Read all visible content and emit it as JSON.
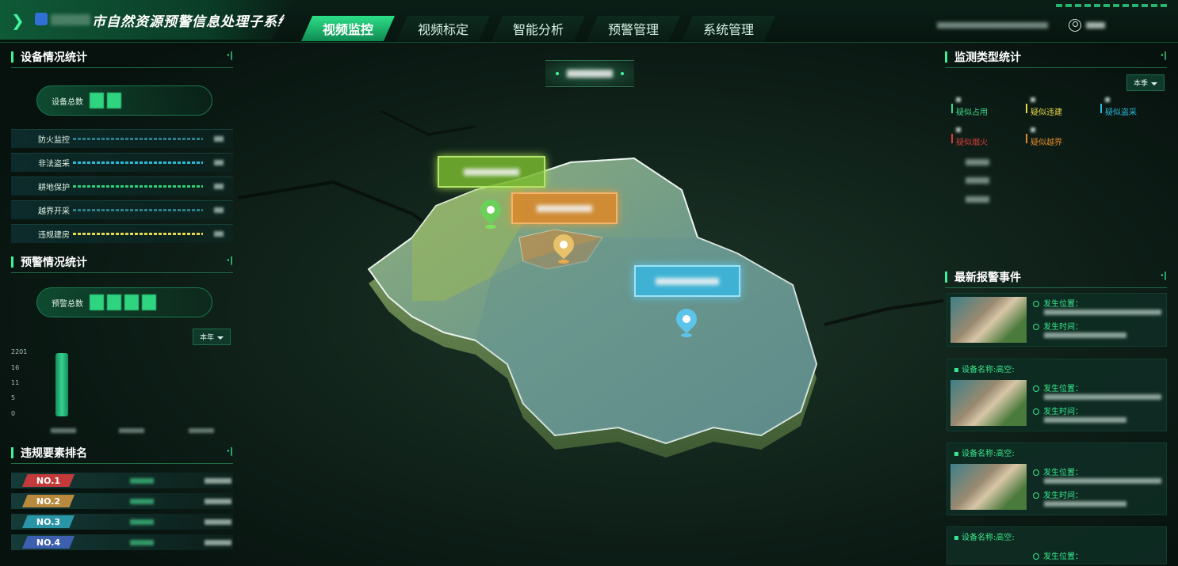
{
  "header": {
    "title": "市自然资源预警信息处理子系统",
    "tabs": [
      "视频监控",
      "视频标定",
      "智能分析",
      "预警管理",
      "系统管理"
    ],
    "active_tab": 0
  },
  "device_stats": {
    "heading": "设备情况统计",
    "total_label": "设备总数",
    "rows": [
      {
        "label": "防火监控",
        "color": "#2a7f8a"
      },
      {
        "label": "非法盗采",
        "color": "#2bb8d8"
      },
      {
        "label": "耕地保护",
        "color": "#2fcf72"
      },
      {
        "label": "越界开采",
        "color": "#2a7f8a"
      },
      {
        "label": "违规建房",
        "color": "#e6d84a"
      }
    ]
  },
  "alert_stats": {
    "heading": "预警情况统计",
    "total_label": "预警总数",
    "period": "本年",
    "y_ticks": [
      "2201",
      "16",
      "11",
      "5",
      "0"
    ]
  },
  "ranking": {
    "heading": "违规要素排名",
    "items": [
      {
        "rank": "NO.1",
        "color": "#c43a3a"
      },
      {
        "rank": "NO.2",
        "color": "#b98a3d"
      },
      {
        "rank": "NO.3",
        "color": "#2b95a8"
      },
      {
        "rank": "NO.4",
        "color": "#3c5fb0"
      }
    ]
  },
  "monitor_types": {
    "heading": "监测类型统计",
    "period": "本季",
    "items": [
      {
        "label": "疑似占用",
        "color": "#3fd68a"
      },
      {
        "label": "疑似违建",
        "color": "#e6d84a"
      },
      {
        "label": "疑似盗采",
        "color": "#2bb8d8"
      },
      {
        "label": "疑似烟火",
        "color": "#d83a3a"
      },
      {
        "label": "疑似越界",
        "color": "#e08a2c"
      }
    ]
  },
  "latest_alerts": {
    "heading": "最新报警事件",
    "location_label": "发生位置：",
    "time_label": "发生时间：",
    "device_label": "设备名称:高空:",
    "items": [
      1,
      2,
      3,
      4
    ]
  },
  "map": {
    "regions": [
      {
        "color": "#78b92f"
      },
      {
        "color": "#d9892c"
      },
      {
        "color": "#38b7e0"
      }
    ]
  }
}
